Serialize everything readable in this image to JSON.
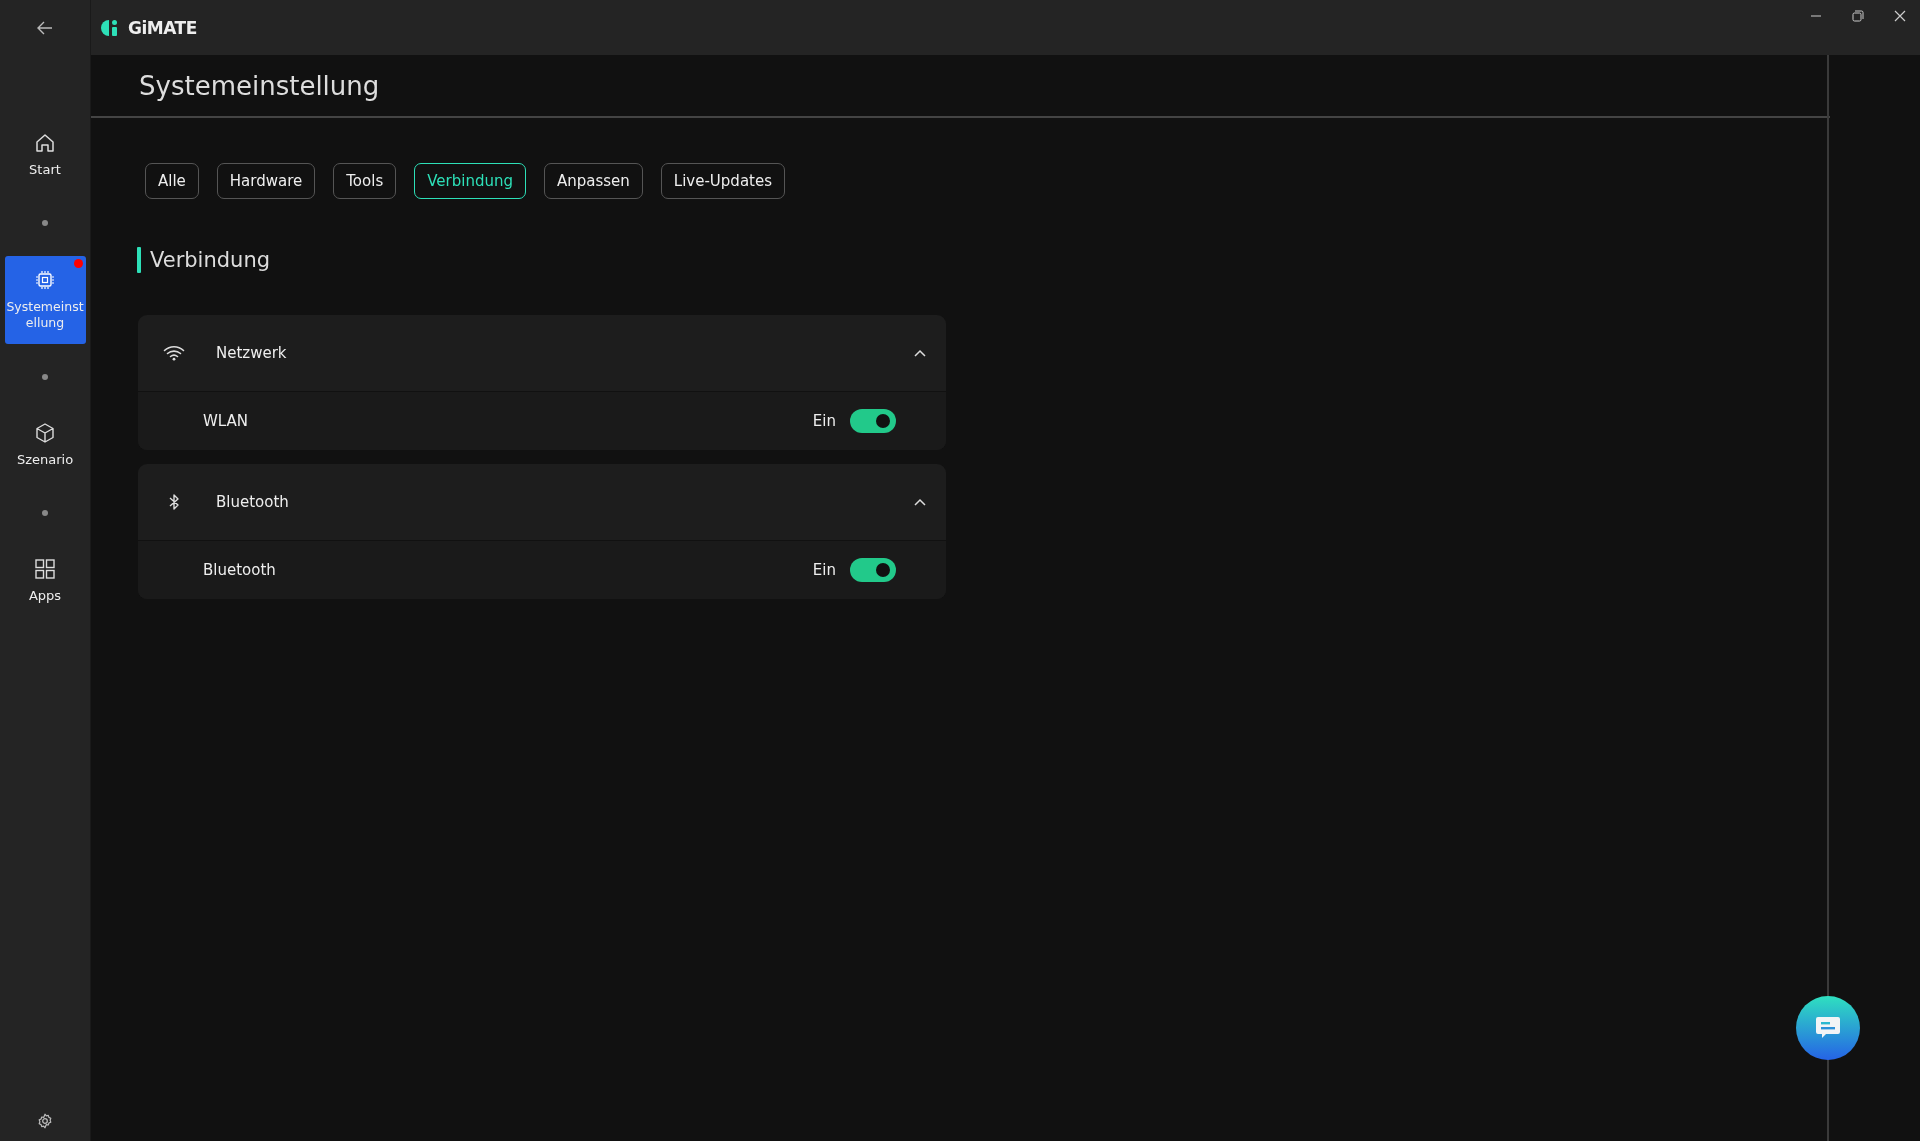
{
  "app": {
    "name": "GiMATE"
  },
  "sidebar": {
    "items": [
      {
        "kind": "home",
        "label": "Start",
        "selected": false,
        "notification": false
      },
      {
        "kind": "chip",
        "label": "Systemeinst ellung",
        "selected": true,
        "notification": true
      },
      {
        "kind": "cube",
        "label": "Szenario",
        "selected": false,
        "notification": false
      },
      {
        "kind": "grid",
        "label": "Apps",
        "selected": false,
        "notification": false
      }
    ]
  },
  "page": {
    "title": "Systemeinstellung"
  },
  "tabs": [
    {
      "label": "Alle",
      "selected": false
    },
    {
      "label": "Hardware",
      "selected": false
    },
    {
      "label": "Tools",
      "selected": false
    },
    {
      "label": "Verbindung",
      "selected": true
    },
    {
      "label": "Anpassen",
      "selected": false
    },
    {
      "label": "Live-Updates",
      "selected": false
    }
  ],
  "section": {
    "title": "Verbindung"
  },
  "groups": [
    {
      "kind": "wifi",
      "title": "Netzwerk",
      "expanded": true,
      "settings": [
        {
          "label": "WLAN",
          "state_text": "Ein",
          "on": true
        }
      ]
    },
    {
      "kind": "bluetooth",
      "title": "Bluetooth",
      "expanded": true,
      "settings": [
        {
          "label": "Bluetooth",
          "state_text": "Ein",
          "on": true
        }
      ]
    }
  ]
}
